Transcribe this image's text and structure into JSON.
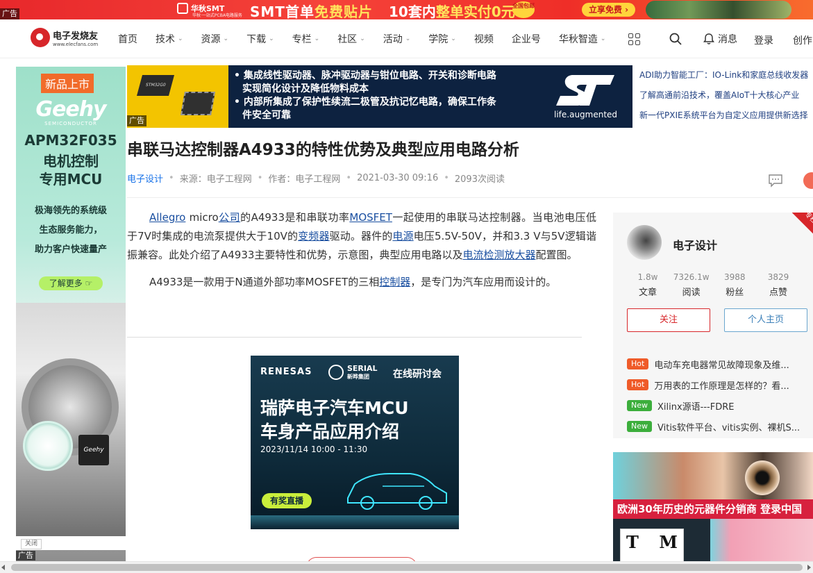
{
  "top_banner": {
    "ad_tag": "广告",
    "brand_name": "华秋SMT",
    "brand_sub": "华秋·一站式PCBA电路服务",
    "slogan1_a": "SMT首单",
    "slogan1_b": "免费贴片",
    "slogan2_a": "10套内",
    "slogan2_b": "整单实付0元",
    "badge": "全国包邮",
    "cta": "立享免费 ›"
  },
  "nav": {
    "logo_name": "电子发烧友",
    "logo_url": "www.elecfans.com",
    "items": [
      {
        "label": "首页",
        "caret": false
      },
      {
        "label": "技术",
        "caret": true
      },
      {
        "label": "资源",
        "caret": true
      },
      {
        "label": "下载",
        "caret": true
      },
      {
        "label": "专栏",
        "caret": true
      },
      {
        "label": "社区",
        "caret": true
      },
      {
        "label": "活动",
        "caret": true
      },
      {
        "label": "学院",
        "caret": true
      },
      {
        "label": "视频",
        "caret": false
      },
      {
        "label": "企业号",
        "caret": false
      },
      {
        "label": "华秋智造",
        "caret": true
      }
    ],
    "messages": "消息",
    "login": "登录",
    "create": "创作"
  },
  "left_ad": {
    "new_tag": "新品上市",
    "brand": "Geehy",
    "semi": "SEMICONDUCTOR",
    "model": "APM32F035",
    "line2": "电机控制",
    "line3": "专用MCU",
    "desc1": "极海领先的系统级",
    "desc2": "生态服务能力，",
    "desc3": "助力客户快速量产",
    "more": "了解更多",
    "chip_label": "Geehy",
    "close": "关闭",
    "ad_tag": "广告"
  },
  "st_ad": {
    "chip_label": "STM32G0",
    "line1": "• 集成线性驱动器、脉冲驱动器与钳位电路、开关和诊断电路",
    "line2": "实现简化设计及降低物料成本",
    "line3": "• 内部所集成了保护性续流二极管及抗记忆电路，确保工作条",
    "line4": "件安全可靠",
    "tagline": "life.augmented",
    "ad_tag": "广告"
  },
  "side_links": [
    "ADI助力智能工厂：IO-Link和家庭总线收发器",
    "了解高通前沿技术，覆盖AIoT十大核心产业",
    "新一代PXIE系统平台为自定义应用提供新选择"
  ],
  "article": {
    "title": "串联马达控制器A4933的特性优势及典型应用电路分析",
    "category": "电子设计",
    "source": "来源：电子工程网",
    "author": "作者：电子工程网",
    "date": "2021-03-30 09:16",
    "reads": "2093次阅读",
    "p1": {
      "link1": "Allegro",
      "t1": " micro",
      "link2": "公司",
      "t2": "的A4933是和串联功率",
      "link3": "MOSFET",
      "t3": "一起使用的串联马达控制器。当电池电压低于7V时集成的电流泵提供大于10V的",
      "link4": "变频器",
      "t4": "驱动。器件的",
      "link5": "电源",
      "t5": "电压5.5V-50V，并和3.3 V与5V逻辑谐振兼容。此处介绍了A4933主要特性和优势，示意图，典型应用电路以及",
      "link6": "电流检测放大器",
      "t6": "配置图。"
    },
    "p2": {
      "t1": "A4933是一款用于N通道外部功率MOSFET的三相",
      "link1": "控制器",
      "t2": "，是专门为汽车应用而设计的。"
    }
  },
  "ren_ad": {
    "brand": "RENESAS",
    "serial": "SERIAL",
    "serial_sub": "新晔集团",
    "webinar": "在线研讨会",
    "h1": "瑞萨电子汽车MCU",
    "h2": "车身产品应用介绍",
    "date": "2023/11/14  10:00 - 11:30",
    "live": "有奖直播"
  },
  "author_card": {
    "corner": "专栏",
    "name": "电子设计",
    "stats": [
      {
        "num": "1.8w",
        "label": "文章"
      },
      {
        "num": "7326.1w",
        "label": "阅读"
      },
      {
        "num": "3988",
        "label": "粉丝"
      },
      {
        "num": "3829",
        "label": "点赞"
      }
    ],
    "follow": "关注",
    "home": "个人主页",
    "hot_list": [
      {
        "tag": "Hot",
        "type": "hot",
        "text": "电动车充电器常见故障现象及维..."
      },
      {
        "tag": "Hot",
        "type": "hot",
        "text": "万用表的工作原理是怎样的？看..."
      },
      {
        "tag": "New",
        "type": "new",
        "text": "Xilinx源语---FDRE"
      },
      {
        "tag": "New",
        "type": "new",
        "text": "Vitis软件平台、vitis实例、裸机S..."
      }
    ]
  },
  "right_ad": {
    "band": "欧洲30年历史的元器件分销商 登录中国",
    "tm_a": "T",
    "tm_b": "M"
  }
}
